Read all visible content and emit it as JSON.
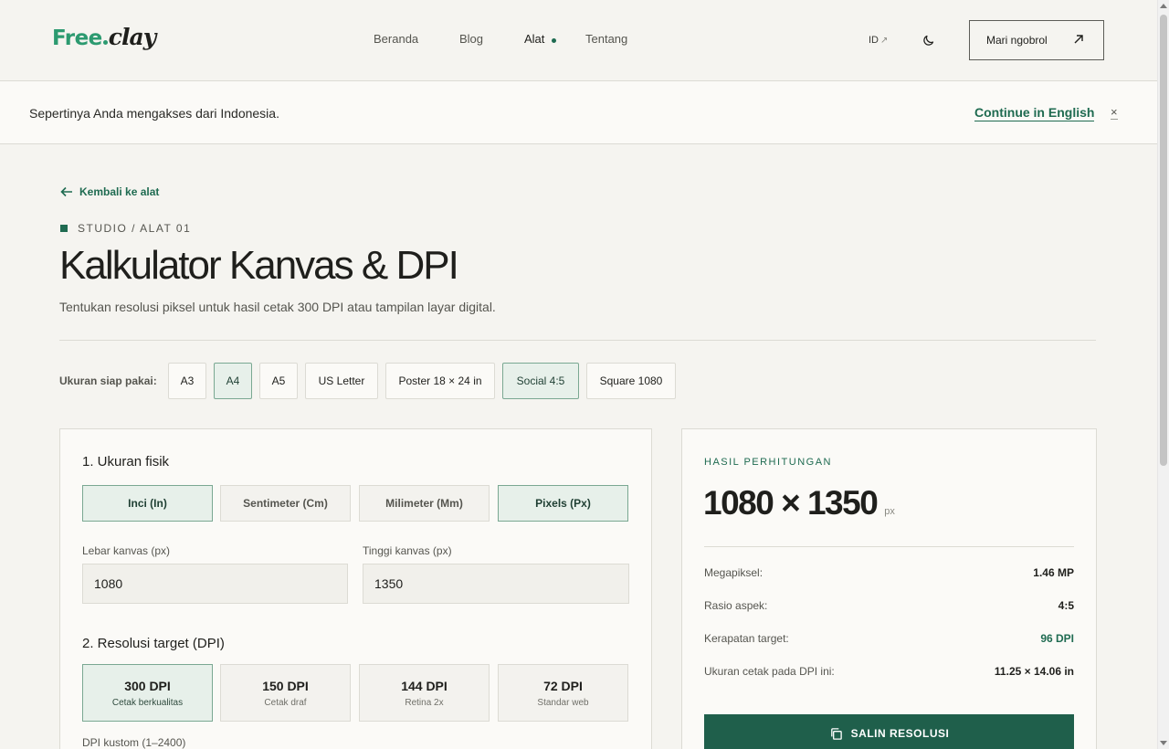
{
  "header": {
    "logo_free": "Free",
    "logo_clay": "clay",
    "nav": [
      "Beranda",
      "Blog",
      "Alat",
      "Tentang"
    ],
    "nav_active": "Alat",
    "lang": "ID",
    "cta": "Mari ngobrol"
  },
  "banner": {
    "text": "Sepertinya Anda mengakses dari Indonesia.",
    "link": "Continue in English",
    "close": "×"
  },
  "page": {
    "back": "Kembali ke alat",
    "eyebrow": "STUDIO / ALAT 01",
    "title": "Kalkulator Kanvas & DPI",
    "subtitle": "Tentukan resolusi piksel untuk hasil cetak 300 DPI atau tampilan layar digital."
  },
  "presets": {
    "label": "Ukuran siap pakai:",
    "items": [
      "A3",
      "A4",
      "A5",
      "US Letter",
      "Poster 18 × 24 in",
      "Social 4:5",
      "Square 1080"
    ],
    "selected": [
      "A4",
      "Social 4:5"
    ]
  },
  "physical": {
    "title": "1. Ukuran fisik",
    "units": [
      "Inci (In)",
      "Sentimeter (Cm)",
      "Milimeter (Mm)",
      "Pixels (Px)"
    ],
    "selected_units": [
      "Inci (In)",
      "Pixels (Px)"
    ],
    "width_label": "Lebar kanvas (px)",
    "width_value": "1080",
    "height_label": "Tinggi kanvas (px)",
    "height_value": "1350"
  },
  "dpi": {
    "title": "2. Resolusi target (DPI)",
    "options": [
      {
        "value": "300 DPI",
        "sub": "Cetak berkualitas"
      },
      {
        "value": "150 DPI",
        "sub": "Cetak draf"
      },
      {
        "value": "144 DPI",
        "sub": "Retina 2x"
      },
      {
        "value": "72 DPI",
        "sub": "Standar web"
      }
    ],
    "selected": "300 DPI",
    "custom_label": "DPI kustom (1–2400)"
  },
  "result": {
    "eyebrow": "HASIL PERHITUNGAN",
    "value": "1080 × 1350",
    "unit": "px",
    "stats": [
      {
        "label": "Megapiksel:",
        "value": "1.46 MP"
      },
      {
        "label": "Rasio aspek:",
        "value": "4:5"
      },
      {
        "label": "Kerapatan target:",
        "value": "96 DPI"
      },
      {
        "label": "Ukuran cetak pada DPI ini:",
        "value": "11.25 × 14.06 in"
      }
    ],
    "copy_button": "SALIN RESOLUSI"
  },
  "colors": {
    "accent": "#1f6b51",
    "brand": "#2c9a70",
    "background": "#f5f4f0",
    "selected_fill": "#e7f0ea"
  }
}
